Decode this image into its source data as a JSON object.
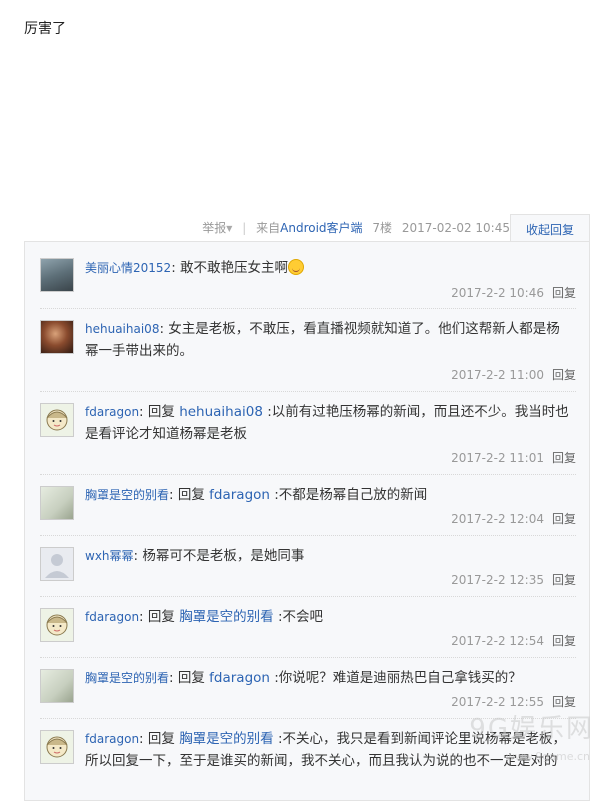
{
  "post": {
    "text": "厉害了"
  },
  "meta": {
    "report": "举报",
    "source_prefix": "来自",
    "source_client": "Android客户端",
    "floor": "7楼",
    "datetime": "2017-02-02 10:45",
    "collapse": "收起回复"
  },
  "reply_action": "回复",
  "reply_word": "回复",
  "replies": [
    {
      "user": "美丽心情20152",
      "text": ": 敢不敢艳压女主啊",
      "time": "2017-2-2 10:46"
    },
    {
      "user": "hehuaihai08",
      "text": ": 女主是老板，不敢压，看直播视频就知道了。他们这帮新人都是杨幂一手带出来的。",
      "time": "2017-2-2 11:00"
    },
    {
      "user": "fdaragon",
      "target": "hehuaihai08",
      "text": " :以前有过艳压杨幂的新闻，而且还不少。我当时也是看评论才知道杨幂是老板",
      "time": "2017-2-2 11:01"
    },
    {
      "user": "胸罩是空的别看",
      "target": "fdaragon",
      "text": " :不都是杨幂自己放的新闻",
      "time": "2017-2-2 12:04"
    },
    {
      "user": "wxh幂幂",
      "text": ": 杨幂可不是老板，是她同事",
      "time": "2017-2-2 12:35"
    },
    {
      "user": "fdaragon",
      "target": "胸罩是空的别看",
      "text": " :不会吧",
      "time": "2017-2-2 12:54"
    },
    {
      "user": "胸罩是空的别看",
      "target": "fdaragon",
      "text": " :你说呢？难道是迪丽热巴自己拿钱买的？",
      "time": "2017-2-2 12:55"
    },
    {
      "user": "fdaragon",
      "target": "胸罩是空的别看",
      "text": " :不关心，我只是看到新闻评论里说杨幂是老板，所以回复一下，至于是谁买的新闻，我不关心，而且我认为说的也不一定是对的"
    }
  ],
  "watermark": {
    "main": "9G娱乐网",
    "sub": "www.9game.cn"
  }
}
